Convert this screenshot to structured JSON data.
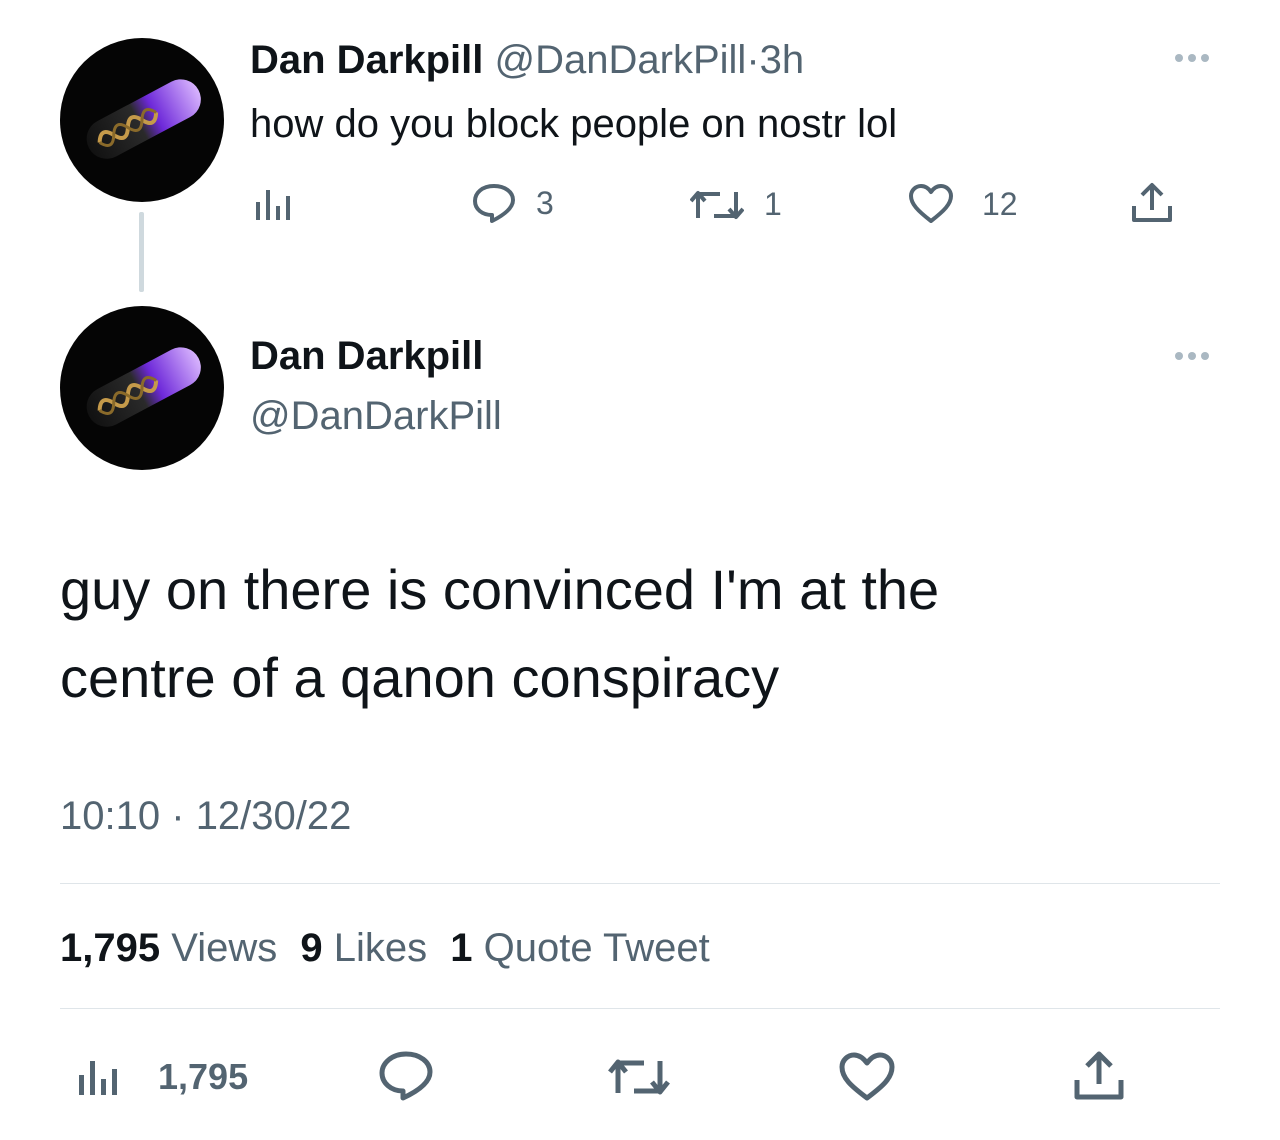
{
  "reply_tweet": {
    "display_name": "Dan Darkpill",
    "handle": "@DanDarkPill",
    "separator": "·",
    "time_ago": "3h",
    "text": "how do you block people on nostr lol",
    "reply_count": "3",
    "retweet_count": "1",
    "like_count": "12"
  },
  "main_tweet": {
    "display_name": "Dan Darkpill",
    "handle": "@DanDarkPill",
    "text_line1": "guy on there is convinced I'm at the",
    "text_line2": "centre of a qanon conspiracy",
    "time": "10:10",
    "separator": "·",
    "date": "12/30/22",
    "stats": {
      "views_count": "1,795",
      "views_label": "Views",
      "likes_count": "9",
      "likes_label": "Likes",
      "quotes_count": "1",
      "quotes_label": "Quote Tweet"
    },
    "action_views_count": "1,795"
  },
  "icons": [
    "analytics-icon",
    "reply-icon",
    "retweet-icon",
    "like-icon",
    "share-icon",
    "more-icon"
  ],
  "colors": {
    "muted": "#536471",
    "text": "#0f1419",
    "avatar_pill": "#a855f7"
  }
}
